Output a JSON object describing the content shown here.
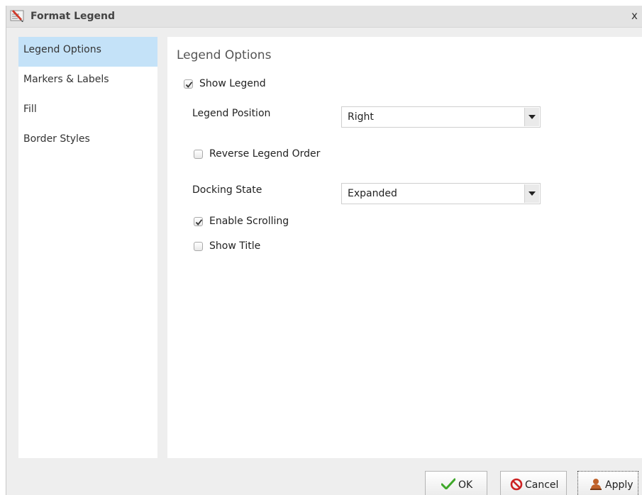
{
  "window": {
    "title": "Format Legend",
    "close_label": "x"
  },
  "sidebar": {
    "items": [
      {
        "label": "Legend Options",
        "active": true
      },
      {
        "label": "Markers & Labels",
        "active": false
      },
      {
        "label": "Fill",
        "active": false
      },
      {
        "label": "Border Styles",
        "active": false
      }
    ]
  },
  "main": {
    "section_title": "Legend Options",
    "show_legend": {
      "label": "Show Legend",
      "checked": true
    },
    "legend_position": {
      "label": "Legend Position",
      "value": "Right"
    },
    "reverse_order": {
      "label": "Reverse Legend Order",
      "checked": false
    },
    "docking_state": {
      "label": "Docking State",
      "value": "Expanded"
    },
    "enable_scrolling": {
      "label": "Enable Scrolling",
      "checked": true
    },
    "show_title": {
      "label": "Show Title",
      "checked": false
    }
  },
  "buttons": {
    "ok": "OK",
    "cancel": "Cancel",
    "apply": "Apply"
  },
  "colors": {
    "active_nav": "#c4e2f8",
    "ok_check": "#3fa82a",
    "cancel_icon": "#cc2222"
  },
  "icons": {
    "title": "format-legend-icon",
    "ok": "checkmark-icon",
    "cancel": "prohibited-icon",
    "apply": "user-stamp-icon",
    "dropdown": "triangle-down-icon"
  }
}
